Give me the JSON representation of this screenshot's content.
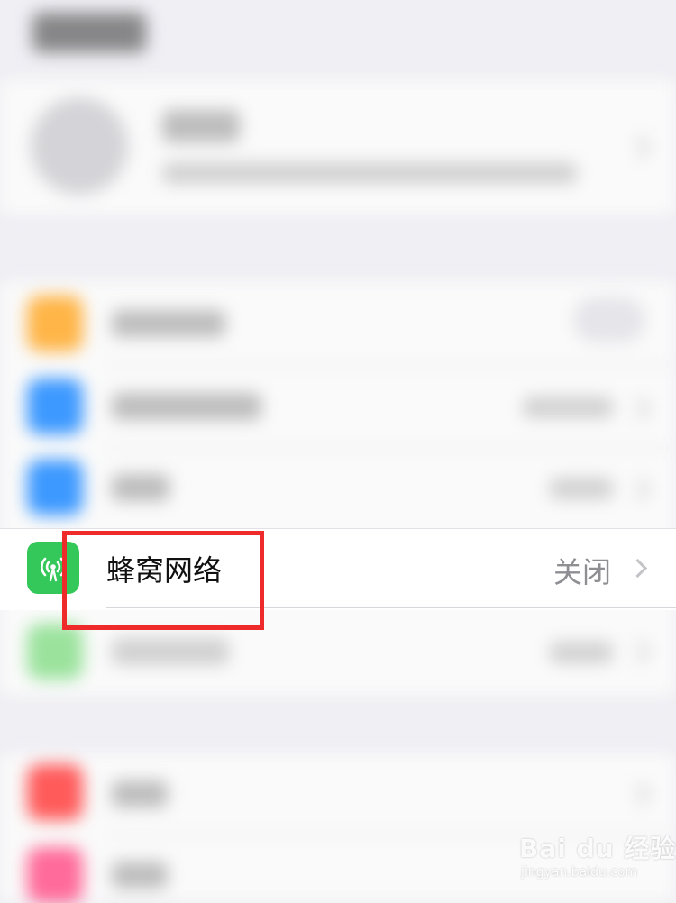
{
  "screen": "settings",
  "cellular_row": {
    "label": "蜂窝网络",
    "value": "关闭",
    "icon": "cellular-antenna-icon",
    "icon_color": "#34c759"
  },
  "highlight": {
    "color": "#ee2a2a"
  },
  "blurred_rows": [
    {
      "icon_color": "#ffb547"
    },
    {
      "icon_color": "#3d99ff"
    },
    {
      "icon_color": "#3d99ff"
    },
    {
      "icon_color": "#9be39d"
    },
    {
      "icon_color": "#ff5b5b"
    },
    {
      "icon_color": "#ff6b9a"
    }
  ],
  "watermark": {
    "brand": "Bai du 经验",
    "url": "jingyan.baidu.com"
  }
}
